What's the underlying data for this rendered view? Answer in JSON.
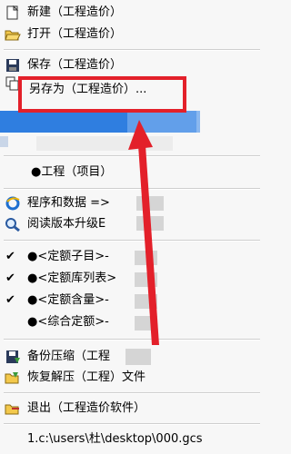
{
  "menu": {
    "items": [
      {
        "label": "新建（工程造价）",
        "icon": "new-document-icon"
      },
      {
        "label": "打开（工程造价）",
        "icon": "open-folder-icon"
      },
      {
        "label": "保存（工程造价）",
        "icon": "save-floppy-icon"
      },
      {
        "label": "另存为（工程造价）...",
        "icon": "save-as-icon"
      },
      {
        "label": "●工程（项目）"
      },
      {
        "label": "程序和数据 =>",
        "icon": "internet-explorer-icon"
      },
      {
        "label": "阅读版本升级E",
        "icon": "magnifier-icon"
      },
      {
        "label": "●<定额子目>-"
      },
      {
        "label": "●<定额库列表>"
      },
      {
        "label": "●<定额含量>-"
      },
      {
        "label": "●<综合定额>-"
      },
      {
        "label": "备份压缩（工程",
        "icon": "backup-icon"
      },
      {
        "label": "恢复解压（工程）文件",
        "icon": "restore-icon"
      },
      {
        "label": "退出（工程造价软件）",
        "icon": "exit-icon"
      },
      {
        "label": "1.c:\\users\\杜\\desktop\\000.gcs"
      }
    ],
    "checks": [
      "✔",
      "✔",
      "✔"
    ]
  },
  "colors": {
    "highlight": "#2f7ee0",
    "annotation": "#e3202a"
  }
}
